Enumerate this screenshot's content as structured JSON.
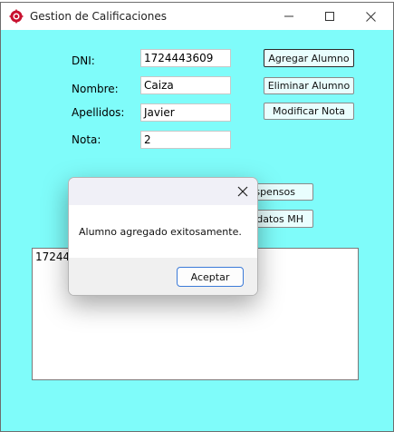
{
  "window": {
    "title": "Gestion de Calificaciones",
    "minimize_icon": "minimize-icon",
    "maximize_icon": "maximize-icon",
    "close_icon": "close-icon"
  },
  "form": {
    "dni_label": "DNI:",
    "dni_value": "1724443609",
    "nombre_label": "Nombre:",
    "nombre_value": "Caiza",
    "apellidos_label": "Apellidos:",
    "apellidos_value": "Javier",
    "nota_label": "Nota:",
    "nota_value": "2"
  },
  "buttons": {
    "agregar": "Agregar Alumno",
    "eliminar": "Eliminar Alumno",
    "modificar": "Modificar Nota",
    "suspensos_visible": "uspensos",
    "candidatos_visible": "didatos MH"
  },
  "list": {
    "visible_text": "172444"
  },
  "dialog": {
    "message": "Alumno agregado exitosamente.",
    "ok_label": "Aceptar"
  },
  "colors": {
    "client_background": "#7ffcfa",
    "dialog_button_border": "#3c7bd8"
  }
}
